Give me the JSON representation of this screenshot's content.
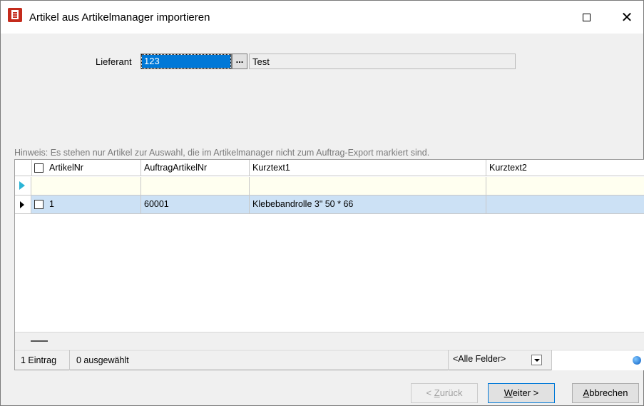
{
  "window": {
    "title": "Artikel aus Artikelmanager importieren"
  },
  "form": {
    "lieferant_label": "Lieferant",
    "lieferant_value": "123",
    "browse_label": "...",
    "supplier_name": "Test"
  },
  "hint": "Hinweis: Es stehen nur Artikel zur Auswahl, die im Artikelmanager nicht zum Auftrag-Export markiert sind.",
  "grid": {
    "columns": [
      "ArtikelNr",
      "AuftragArtikelNr",
      "Kurztext1",
      "Kurztext2"
    ],
    "rows": [
      {
        "artikelnr": "1",
        "auftragartikelnr": "60001",
        "kurztext1": "Klebebandrolle 3\" 50 * 66",
        "kurztext2": ""
      }
    ]
  },
  "status": {
    "count": "1 Eintrag",
    "selected": "0 ausgewählt",
    "field_filter": "<Alle Felder>"
  },
  "buttons": {
    "back_prefix": "< ",
    "back_accel": "Z",
    "back_rest": "urück",
    "next_accel": "W",
    "next_rest": "eiter >",
    "cancel_accel": "A",
    "cancel_rest": "bbrechen"
  }
}
